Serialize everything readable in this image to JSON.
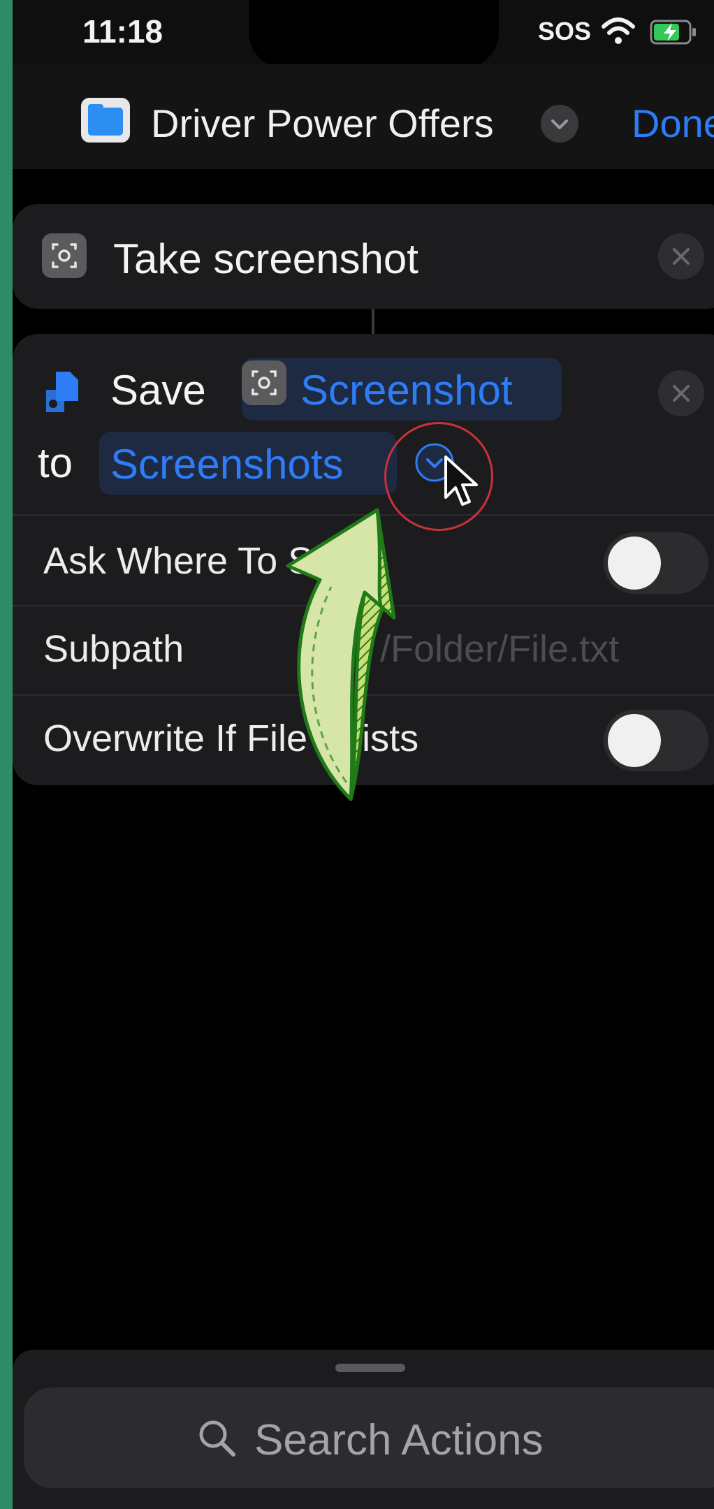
{
  "status_bar": {
    "time": "11:18",
    "carrier": "SOS"
  },
  "nav": {
    "title": "Driver Power Offers",
    "done_label": "Done",
    "app_icon": "files-folder-icon"
  },
  "actions": [
    {
      "title": "Take screenshot",
      "icon": "screenshot-icon"
    },
    {
      "verb": "Save",
      "icon": "files-document-icon",
      "input_token": "Screenshot",
      "connector": "to",
      "destination_token": "Screenshots",
      "options": [
        {
          "label": "Ask Where To Save",
          "type": "toggle",
          "value": false
        },
        {
          "label": "Subpath",
          "type": "text",
          "placeholder": "/Folder/File.txt"
        },
        {
          "label": "Overwrite If File Exists",
          "type": "toggle",
          "value": false
        }
      ]
    }
  ],
  "search": {
    "placeholder": "Search Actions"
  },
  "colors": {
    "accent": "#2e7cf6",
    "card": "#1c1c1e",
    "background": "#000000",
    "annotation_arrow": "#d6e6a8",
    "annotation_circle": "#c8323c"
  }
}
